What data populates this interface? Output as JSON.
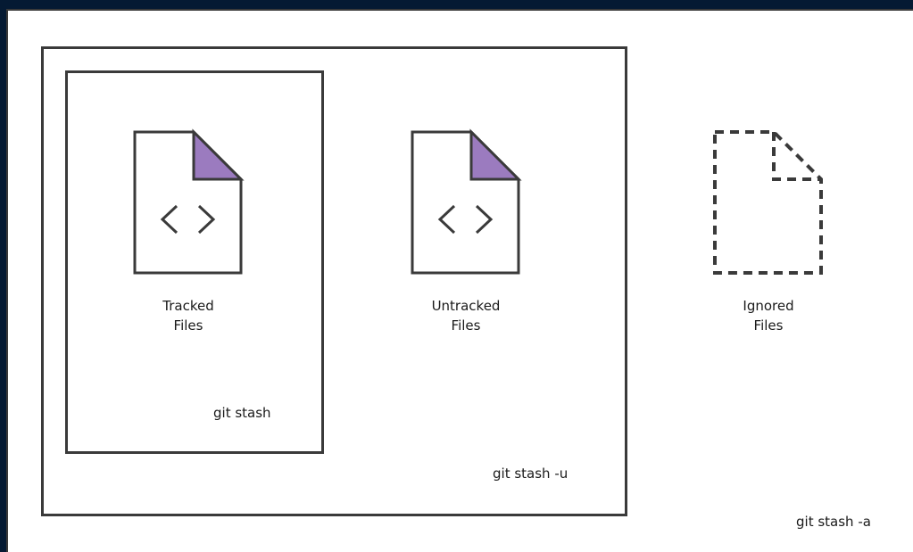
{
  "files": [
    {
      "label_line1": "Tracked",
      "label_line2": "Files",
      "icon": "code-file-icon"
    },
    {
      "label_line1": "Untracked",
      "label_line2": "Files",
      "icon": "code-file-icon"
    },
    {
      "label_line1": "Ignored",
      "label_line2": "Files",
      "icon": "dashed-file-icon"
    }
  ],
  "boxes": {
    "stash": "git stash",
    "stash_u": "git stash -u",
    "stash_a": "git stash -a"
  },
  "colors": {
    "background": "#051a33",
    "panel": "#ffffff",
    "stroke": "#3a3a3a",
    "fold_accent": "#9b7bbf"
  }
}
